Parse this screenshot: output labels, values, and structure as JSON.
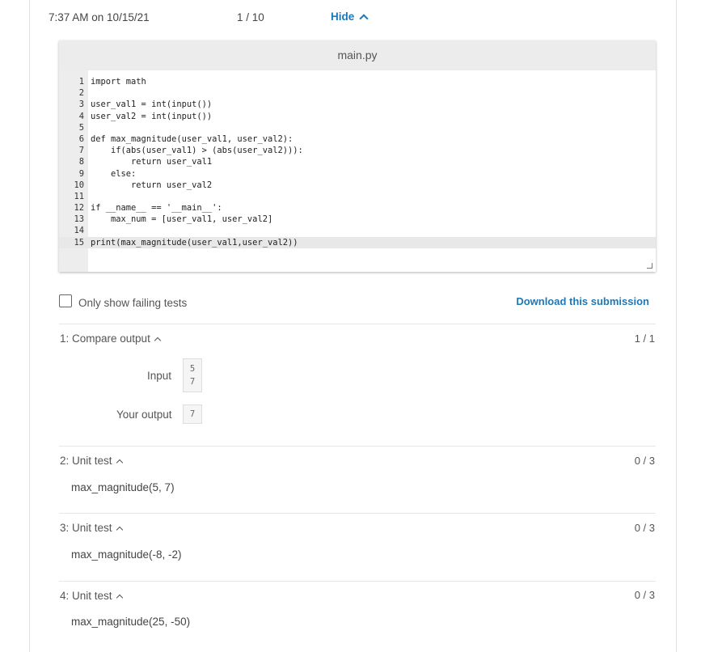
{
  "header": {
    "timestamp": "7:37 AM on 10/15/21",
    "submission_count": "1 / 10",
    "hide_label": "Hide"
  },
  "editor": {
    "filename": "main.py",
    "lines": [
      {
        "n": "1",
        "text": "import math"
      },
      {
        "n": "2",
        "text": ""
      },
      {
        "n": "3",
        "text": "user_val1 = int(input())"
      },
      {
        "n": "4",
        "text": "user_val2 = int(input())"
      },
      {
        "n": "5",
        "text": ""
      },
      {
        "n": "6",
        "text": "def max_magnitude(user_val1, user_val2):"
      },
      {
        "n": "7",
        "text": "    if(abs(user_val1) > (abs(user_val2))):"
      },
      {
        "n": "8",
        "text": "        return user_val1"
      },
      {
        "n": "9",
        "text": "    else:"
      },
      {
        "n": "10",
        "text": "        return user_val2"
      },
      {
        "n": "11",
        "text": ""
      },
      {
        "n": "12",
        "text": "if __name__ == '__main__':"
      },
      {
        "n": "13",
        "text": "    max_num = [user_val1, user_val2]"
      },
      {
        "n": "14",
        "text": ""
      },
      {
        "n": "15",
        "text": "print(max_magnitude(user_val1,user_val2))"
      }
    ]
  },
  "filters": {
    "only_failing_label": "Only show failing tests",
    "only_failing_checked": false,
    "download_label": "Download this submission"
  },
  "tests": {
    "compare": {
      "title": "1: Compare output",
      "score": "1 / 1",
      "input_label": "Input",
      "input_values": [
        "5",
        "7"
      ],
      "output_label": "Your output",
      "output_values": [
        "7"
      ]
    },
    "unit": [
      {
        "title": "2: Unit test",
        "score": "0 / 3",
        "call": "max_magnitude(5, 7)"
      },
      {
        "title": "3: Unit test",
        "score": "0 / 3",
        "call": "max_magnitude(-8, -2)"
      },
      {
        "title": "4: Unit test",
        "score": "0 / 3",
        "call": "max_magnitude(25, -50)"
      }
    ]
  },
  "colors": {
    "accent": "#1f77b4",
    "editor_header": "#ececec",
    "active_line": "#e8e8e8"
  }
}
